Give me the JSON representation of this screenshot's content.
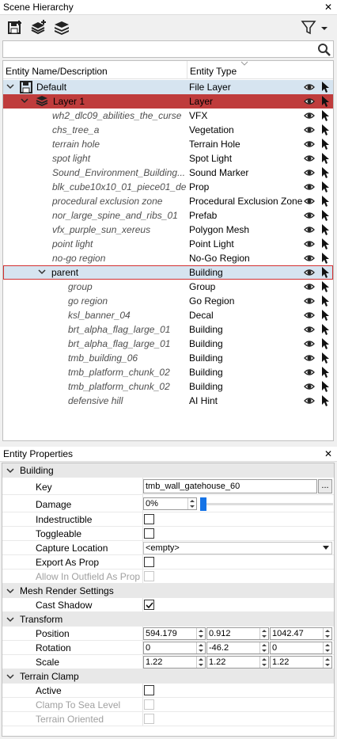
{
  "hierarchy": {
    "title": "Scene Hierarchy",
    "search_value": "",
    "col_name": "Entity Name/Description",
    "col_type": "Entity Type",
    "rows": [
      {
        "name": "Default",
        "type": "File Layer"
      },
      {
        "name": "Layer 1",
        "type": "Layer"
      },
      {
        "name": "wh2_dlc09_abilities_the_curse",
        "type": "VFX"
      },
      {
        "name": "chs_tree_a",
        "type": "Vegetation"
      },
      {
        "name": "terrain hole",
        "type": "Terrain Hole"
      },
      {
        "name": "spot light",
        "type": "Spot Light"
      },
      {
        "name": "Sound_Environment_Building...",
        "type": "Sound Marker"
      },
      {
        "name": "blk_cube10x10_01_piece01_de...",
        "type": "Prop"
      },
      {
        "name": "procedural exclusion zone",
        "type": "Procedural Exclusion Zone"
      },
      {
        "name": "nor_large_spine_and_ribs_01",
        "type": "Prefab"
      },
      {
        "name": "vfx_purple_sun_xereus",
        "type": "Polygon Mesh"
      },
      {
        "name": "point light",
        "type": "Point Light"
      },
      {
        "name": "no-go region",
        "type": "No-Go Region"
      },
      {
        "name": "parent",
        "type": "Building"
      },
      {
        "name": "group",
        "type": "Group"
      },
      {
        "name": "go region",
        "type": "Go Region"
      },
      {
        "name": "ksl_banner_04",
        "type": "Decal"
      },
      {
        "name": "brt_alpha_flag_large_01",
        "type": "Building"
      },
      {
        "name": "brt_alpha_flag_large_01",
        "type": "Building"
      },
      {
        "name": "tmb_building_06",
        "type": "Building"
      },
      {
        "name": "tmb_platform_chunk_02",
        "type": "Building"
      },
      {
        "name": "tmb_platform_chunk_02",
        "type": "Building"
      },
      {
        "name": "defensive hill",
        "type": "AI Hint"
      }
    ]
  },
  "properties": {
    "title": "Entity Properties",
    "building": {
      "section": "Building",
      "key_label": "Key",
      "key_value": "tmb_wall_gatehouse_60",
      "key_button": "...",
      "damage_label": "Damage",
      "damage_value": "0%",
      "damage_level": 0,
      "indestructible_label": "Indestructible",
      "toggleable_label": "Toggleable",
      "capture_label": "Capture Location",
      "capture_value": "<empty>",
      "export_label": "Export As Prop",
      "outfield_label": "Allow In Outfield As Prop"
    },
    "mesh": {
      "section": "Mesh Render Settings",
      "cast_shadow_label": "Cast Shadow",
      "cast_shadow": true
    },
    "transform": {
      "section": "Transform",
      "position_label": "Position",
      "position": [
        "594.179",
        "0.912",
        "1042.47"
      ],
      "rotation_label": "Rotation",
      "rotation": [
        "0",
        "-46.2",
        "0"
      ],
      "scale_label": "Scale",
      "scale": [
        "1.22",
        "1.22",
        "1.22"
      ]
    },
    "terrain": {
      "section": "Terrain Clamp",
      "active_label": "Active",
      "sea_label": "Clamp To Sea Level",
      "oriented_label": "Terrain Oriented"
    }
  }
}
